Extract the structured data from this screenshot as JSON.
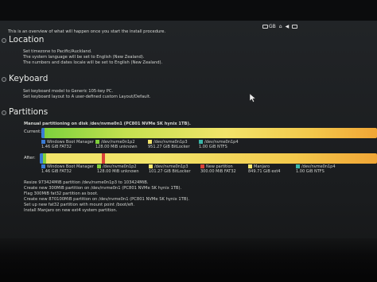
{
  "topbar": {
    "lang": "GB",
    "time": ""
  },
  "intro": "This is an overview of what will happen once you start the install procedure.",
  "location": {
    "title": "Location",
    "lines": [
      "Set timezone to Pacific/Auckland.",
      "The system language will be set to English (New Zealand).",
      "The numbers and dates locale will be set to English (New Zealand)."
    ]
  },
  "keyboard": {
    "title": "Keyboard",
    "lines": [
      "Set keyboard model to Generic 105-key PC.",
      "Set keyboard layout to A user-defined custom Layout/Default."
    ]
  },
  "partitions": {
    "title": "Partitions",
    "heading": "Manual partitioning on disk /dev/nvme0n1 (PC801 NVMe SK hynix 1TB).",
    "current_label": "Current:",
    "after_label": "After:",
    "current_legend": [
      {
        "name": "Windows Boot Manager",
        "size": "1.46 GiB",
        "fs": "FAT32",
        "color": "#3a7bd5"
      },
      {
        "name": "/dev/nvme0n1p2",
        "size": "128.00 MiB",
        "fs": "unknown",
        "color": "#7fcf3a"
      },
      {
        "name": "/dev/nvme0n1p3",
        "size": "951.27 GiB",
        "fs": "BitLocker",
        "color": "#f2e46a"
      },
      {
        "name": "/dev/nvme0n1p4",
        "size": "1.00 GiB",
        "fs": "NTFS",
        "color": "#3ab6a8"
      }
    ],
    "after_legend": [
      {
        "name": "Windows Boot Manager",
        "size": "1.46 GiB",
        "fs": "FAT32",
        "color": "#3a7bd5"
      },
      {
        "name": "/dev/nvme0n1p2",
        "size": "128.00 MiB",
        "fs": "unknown",
        "color": "#7fcf3a"
      },
      {
        "name": "/dev/nvme0n1p3",
        "size": "101.27 GiB",
        "fs": "BitLocker",
        "color": "#f2e46a"
      },
      {
        "name": "New partition",
        "size": "300.00 MiB",
        "fs": "FAT32",
        "color": "#d9423a"
      },
      {
        "name": "Manjaro",
        "size": "849.71 GiB",
        "fs": "ext4",
        "color": "#f2e46a"
      },
      {
        "name": "/dev/nvme0n1p4",
        "size": "1.00 GiB",
        "fs": "NTFS",
        "color": "#3ab6a8"
      }
    ],
    "actions": [
      "Resize 973424MiB partition /dev/nvme0n1p3 to 103424MiB.",
      "Create new 300MiB partition on /dev/nvme0n1 (PC801 NVMe SK hynix 1TB).",
      "Flag 300MiB fat32 partition as boot.",
      "Create new 870100MiB partition on /dev/nvme0n1 (PC801 NVMe SK hynix 1TB).",
      "Set up new fat32 partition with mount point /boot/efi.",
      "Install Manjaro on new ext4 system partition."
    ]
  }
}
